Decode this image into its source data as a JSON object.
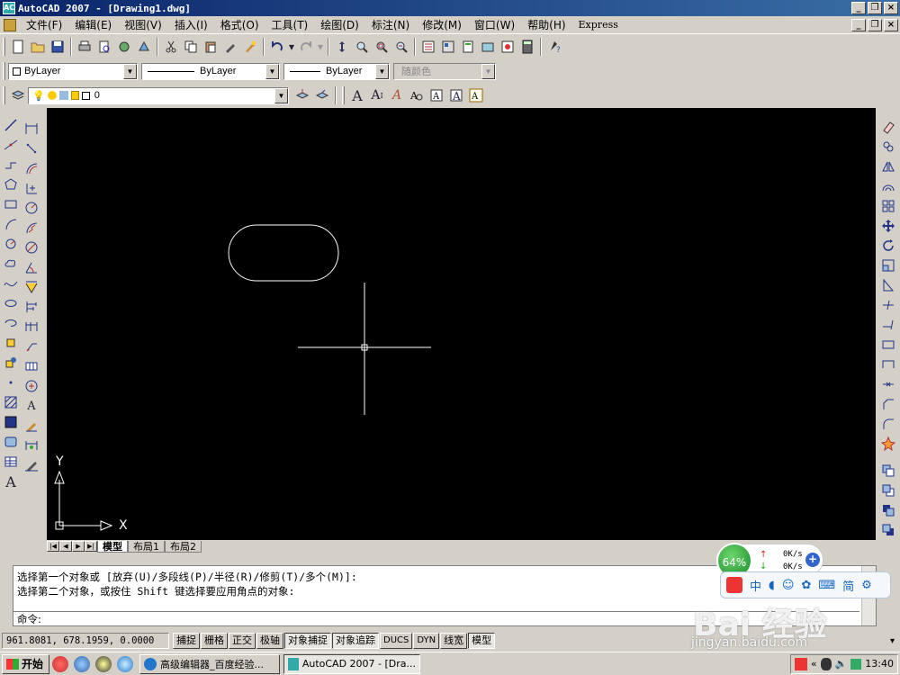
{
  "window": {
    "title": "AutoCAD 2007 - [Drawing1.dwg]",
    "app_icon_text": "AC"
  },
  "window_controls": {
    "minimize": "_",
    "restore": "❐",
    "close": "×"
  },
  "menu": {
    "items": [
      {
        "label": "文件(F)"
      },
      {
        "label": "编辑(E)"
      },
      {
        "label": "视图(V)"
      },
      {
        "label": "插入(I)"
      },
      {
        "label": "格式(O)"
      },
      {
        "label": "工具(T)"
      },
      {
        "label": "绘图(D)"
      },
      {
        "label": "标注(N)"
      },
      {
        "label": "修改(M)"
      },
      {
        "label": "窗口(W)"
      },
      {
        "label": "帮助(H)"
      },
      {
        "label": "Express"
      }
    ]
  },
  "properties": {
    "color": "ByLayer",
    "linetype": "ByLayer",
    "lineweight": "ByLayer",
    "plotstyle": "随颜色"
  },
  "layer": {
    "current": "0"
  },
  "text_toolbar": {
    "icons": [
      "text-icon",
      "mtext-icon",
      "edit-text-icon",
      "find-icon",
      "spell-icon",
      "textstyle-icon",
      "scaletext-icon",
      "justify-icon"
    ]
  },
  "canvas": {
    "background": "#000000",
    "ucs_x": "X",
    "ucs_y": "Y"
  },
  "tabs": {
    "nav": [
      "|◀",
      "◀",
      "▶",
      "▶|"
    ],
    "items": [
      {
        "label": "模型",
        "active": true
      },
      {
        "label": "布局1",
        "active": false
      },
      {
        "label": "布局2",
        "active": false
      }
    ]
  },
  "command": {
    "line1": "选择第一个对象或 [放弃(U)/多段线(P)/半径(R)/修剪(T)/多个(M)]:",
    "line2": "选择第二个对象，或按住 Shift 键选择要应用角点的对象:",
    "prompt": "命令:"
  },
  "status": {
    "coords": "961.8081,  678.1959, 0.0000",
    "buttons": [
      {
        "label": "捕捉",
        "on": false
      },
      {
        "label": "栅格",
        "on": false
      },
      {
        "label": "正交",
        "on": false
      },
      {
        "label": "极轴",
        "on": false
      },
      {
        "label": "对象捕捉",
        "on": true
      },
      {
        "label": "对象追踪",
        "on": true
      },
      {
        "label": "DUCS",
        "on": false
      },
      {
        "label": "DYN",
        "on": false
      },
      {
        "label": "线宽",
        "on": false
      },
      {
        "label": "模型",
        "on": true
      }
    ]
  },
  "netmon": {
    "percent": "64%",
    "up": "0K/s",
    "down": "0K/s"
  },
  "ime": {
    "label": "中",
    "mode": "简"
  },
  "taskbar": {
    "start": "开始",
    "tasks": [
      {
        "label": "高级编辑器_百度经验...",
        "active": false
      },
      {
        "label": "AutoCAD 2007 - [Dra...",
        "active": true
      }
    ],
    "clock": "13:40"
  },
  "watermark": {
    "brand": "Bai 经验",
    "url": "jingyan.baidu.com"
  }
}
